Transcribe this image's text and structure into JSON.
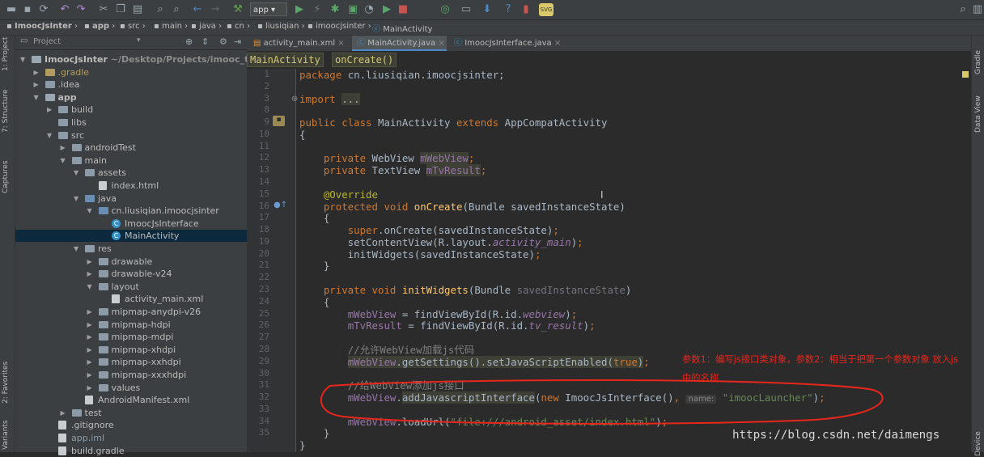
{
  "toolbar": {
    "run_config": "app",
    "svg_badge": "SVG"
  },
  "nav_bar": {
    "crumbs": [
      "ImoocJsInter",
      "app",
      "src",
      "main",
      "java",
      "cn",
      "liusiqian",
      "imoocjsinter",
      "MainActivity"
    ]
  },
  "left_stripe": {
    "tabs": [
      "1: Project",
      "7: Structure",
      "Captures",
      "2: Favorites",
      "Variants"
    ]
  },
  "right_stripe": {
    "tabs": [
      "Gradle",
      "Data View",
      "Device"
    ]
  },
  "project_panel": {
    "view_mode": "Project",
    "tree": [
      {
        "label": "ImoocJsInter",
        "suffix": "~/Desktop/Projects/imooc_tech/i",
        "type": "module",
        "depth": 0,
        "expanded": true
      },
      {
        "label": ".gradle",
        "type": "folder-gold",
        "depth": 1,
        "expanded": false
      },
      {
        "label": ".idea",
        "type": "folder",
        "depth": 1,
        "expanded": false
      },
      {
        "label": "app",
        "type": "module",
        "depth": 1,
        "expanded": true
      },
      {
        "label": "build",
        "type": "folder",
        "depth": 2,
        "expanded": false
      },
      {
        "label": "libs",
        "type": "folder",
        "depth": 2,
        "leaf": true
      },
      {
        "label": "src",
        "type": "folder",
        "depth": 2,
        "expanded": true
      },
      {
        "label": "androidTest",
        "type": "folder",
        "depth": 3,
        "expanded": false
      },
      {
        "label": "main",
        "type": "folder",
        "depth": 3,
        "expanded": true
      },
      {
        "label": "assets",
        "type": "folder",
        "depth": 4,
        "expanded": true
      },
      {
        "label": "index.html",
        "type": "file",
        "depth": 5,
        "leaf": true
      },
      {
        "label": "java",
        "type": "folder-blue",
        "depth": 4,
        "expanded": true
      },
      {
        "label": "cn.liusiqian.imoocjsinter",
        "type": "package",
        "depth": 5,
        "expanded": true
      },
      {
        "label": "ImoocJsInterface",
        "type": "class",
        "depth": 6,
        "leaf": true
      },
      {
        "label": "MainActivity",
        "type": "class",
        "depth": 6,
        "leaf": true,
        "selected": true
      },
      {
        "label": "res",
        "type": "folder",
        "depth": 4,
        "expanded": true
      },
      {
        "label": "drawable",
        "type": "folder",
        "depth": 5,
        "expanded": false
      },
      {
        "label": "drawable-v24",
        "type": "folder",
        "depth": 5,
        "expanded": false
      },
      {
        "label": "layout",
        "type": "folder",
        "depth": 5,
        "expanded": true
      },
      {
        "label": "activity_main.xml",
        "type": "file",
        "depth": 6,
        "leaf": true
      },
      {
        "label": "mipmap-anydpi-v26",
        "type": "folder",
        "depth": 5,
        "expanded": false
      },
      {
        "label": "mipmap-hdpi",
        "type": "folder",
        "depth": 5,
        "expanded": false
      },
      {
        "label": "mipmap-mdpi",
        "type": "folder",
        "depth": 5,
        "expanded": false
      },
      {
        "label": "mipmap-xhdpi",
        "type": "folder",
        "depth": 5,
        "expanded": false
      },
      {
        "label": "mipmap-xxhdpi",
        "type": "folder",
        "depth": 5,
        "expanded": false
      },
      {
        "label": "mipmap-xxxhdpi",
        "type": "folder",
        "depth": 5,
        "expanded": false
      },
      {
        "label": "values",
        "type": "folder",
        "depth": 5,
        "expanded": false
      },
      {
        "label": "AndroidManifest.xml",
        "type": "file",
        "depth": 4,
        "leaf": true
      },
      {
        "label": "test",
        "type": "folder",
        "depth": 3,
        "expanded": false
      },
      {
        "label": ".gitignore",
        "type": "file",
        "depth": 2,
        "leaf": true
      },
      {
        "label": "app.iml",
        "type": "file",
        "depth": 2,
        "leaf": true
      },
      {
        "label": "build.gradle",
        "type": "file",
        "depth": 2,
        "leaf": true
      }
    ]
  },
  "editor": {
    "tabs": [
      {
        "label": "activity_main.xml",
        "active": false
      },
      {
        "label": "MainActivity.java",
        "active": true
      },
      {
        "label": "ImoocJsInterface.java",
        "active": false
      }
    ],
    "code_breadcrumb": [
      "MainActivity",
      "onCreate()"
    ],
    "line_numbers": [
      "1",
      "2",
      "3",
      "8",
      "9",
      "10",
      "11",
      "12",
      "13",
      "14",
      "15",
      "16",
      "17",
      "18",
      "19",
      "20",
      "21",
      "22",
      "23",
      "24",
      "25",
      "26",
      "27",
      "28",
      "29",
      "30",
      "31",
      "32",
      "33",
      "34",
      "35"
    ],
    "lines": [
      [
        [
          "kw",
          "package "
        ],
        [
          "",
          "cn.liusiqian.imoocjsinter;"
        ]
      ],
      [],
      [
        [
          "kw",
          "import "
        ],
        [
          "hl",
          "..."
        ]
      ],
      [],
      [
        [
          "kw",
          "public class "
        ],
        [
          "",
          "MainActivity "
        ],
        [
          "kw",
          "extends "
        ],
        [
          "",
          "AppCompatActivity"
        ]
      ],
      [
        [
          "",
          "{"
        ]
      ],
      [],
      [
        [
          "",
          "    "
        ],
        [
          "kw",
          "private "
        ],
        [
          "",
          "WebView "
        ],
        [
          "fld hl",
          "mWebView"
        ],
        [
          "kw",
          ";"
        ]
      ],
      [
        [
          "",
          "    "
        ],
        [
          "kw",
          "private "
        ],
        [
          "",
          "TextView "
        ],
        [
          "fld hl",
          "mTvResult"
        ],
        [
          "kw",
          ";"
        ]
      ],
      [],
      [
        [
          "",
          "    "
        ],
        [
          "ann",
          "@Override"
        ]
      ],
      [
        [
          "",
          "    "
        ],
        [
          "kw",
          "protected void "
        ],
        [
          "fn",
          "onCreate"
        ],
        [
          "",
          "(Bundle savedInstanceState)"
        ]
      ],
      [
        [
          "",
          "    {"
        ]
      ],
      [
        [
          "",
          "        "
        ],
        [
          "kw",
          "super"
        ],
        [
          "",
          ".onCreate(savedInstanceState)"
        ],
        [
          "kw",
          ";"
        ]
      ],
      [
        [
          "",
          "        setContentView(R.layout."
        ],
        [
          "it",
          "activity_main"
        ],
        [
          "",
          ")"
        ],
        [
          "kw",
          ";"
        ]
      ],
      [
        [
          "",
          "        initWidgets(savedInstanceState)"
        ],
        [
          "kw",
          ";"
        ]
      ],
      [
        [
          "",
          "    }"
        ]
      ],
      [],
      [
        [
          "",
          "    "
        ],
        [
          "kw",
          "private void "
        ],
        [
          "fn",
          "initWidgets"
        ],
        [
          "",
          "(Bundle "
        ],
        [
          "unused",
          "savedInstanceState"
        ],
        [
          "",
          ")"
        ]
      ],
      [
        [
          "",
          "    {"
        ]
      ],
      [
        [
          "",
          "        "
        ],
        [
          "fld",
          "mWebView"
        ],
        [
          "",
          " = findViewById(R.id."
        ],
        [
          "it",
          "webview"
        ],
        [
          "",
          ")"
        ],
        [
          "kw",
          ";"
        ]
      ],
      [
        [
          "",
          "        "
        ],
        [
          "fld",
          "mTvResult"
        ],
        [
          "",
          " = findViewById(R.id."
        ],
        [
          "it",
          "tv_result"
        ],
        [
          "",
          ")"
        ],
        [
          "kw",
          ";"
        ]
      ],
      [],
      [
        [
          "",
          "        "
        ],
        [
          "cm",
          "//允许WebView加载js代码"
        ]
      ],
      [
        [
          "",
          "        "
        ],
        [
          "fld hl",
          "mWebView"
        ],
        [
          "hl",
          ".getSettings().setJavaScriptEnabled("
        ],
        [
          "kw hl",
          "true"
        ],
        [
          "hl",
          ")"
        ],
        [
          "kw",
          ";"
        ]
      ],
      [],
      [
        [
          "",
          "        "
        ],
        [
          "cm",
          "//给WebView添加js接口"
        ]
      ],
      [
        [
          "",
          "        "
        ],
        [
          "fld",
          "mWebView"
        ],
        [
          "",
          "."
        ],
        [
          "hl",
          "addJavascriptInterface"
        ],
        [
          "",
          "("
        ],
        [
          "kw",
          "new "
        ],
        [
          "",
          "ImoocJsInterface()"
        ],
        [
          "kw",
          ", "
        ],
        [
          "hint",
          "name:"
        ],
        [
          "",
          " "
        ],
        [
          "str",
          "\"imoocLauncher\""
        ],
        [
          "",
          ")"
        ],
        [
          "kw",
          ";"
        ]
      ],
      [],
      [
        [
          "",
          "        "
        ],
        [
          "fld",
          "mWebView"
        ],
        [
          "",
          ".loadUrl("
        ],
        [
          "str",
          "\"file:///android_asset/index.html\""
        ],
        [
          "",
          ")"
        ],
        [
          "kw",
          ";"
        ]
      ],
      [
        [
          "",
          "    }"
        ]
      ],
      [
        [
          "",
          "}"
        ]
      ]
    ]
  },
  "annotation": {
    "text": "参数1：编写js接口类对象，参数2：相当于把第一个参数对象 放入js中的名称",
    "color": "#e8261c"
  },
  "watermark": "https://blog.csdn.net/daimengs"
}
